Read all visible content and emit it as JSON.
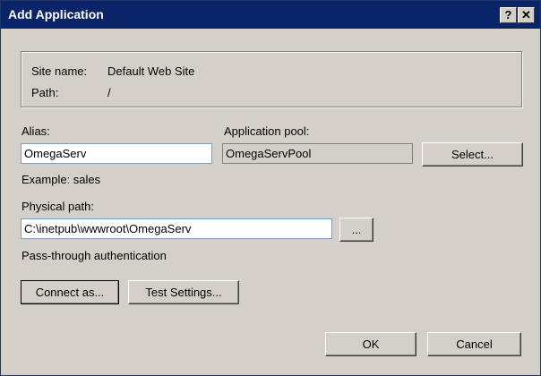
{
  "window": {
    "title": "Add Application"
  },
  "titlebar_buttons": {
    "help": "?",
    "close": "✕"
  },
  "site": {
    "name_label": "Site name:",
    "name_value": "Default Web Site",
    "path_label": "Path:",
    "path_value": "/"
  },
  "alias": {
    "label": "Alias:",
    "value": "OmegaServ",
    "example": "Example: sales"
  },
  "app_pool": {
    "label": "Application pool:",
    "value": "OmegaServPool",
    "select_button": "Select..."
  },
  "physical_path": {
    "label": "Physical path:",
    "value": "C:\\inetpub\\wwwroot\\OmegaServ",
    "browse_button": "...",
    "auth_text": "Pass-through authentication"
  },
  "buttons": {
    "connect_as": "Connect as...",
    "test_settings": "Test Settings...",
    "ok": "OK",
    "cancel": "Cancel"
  }
}
